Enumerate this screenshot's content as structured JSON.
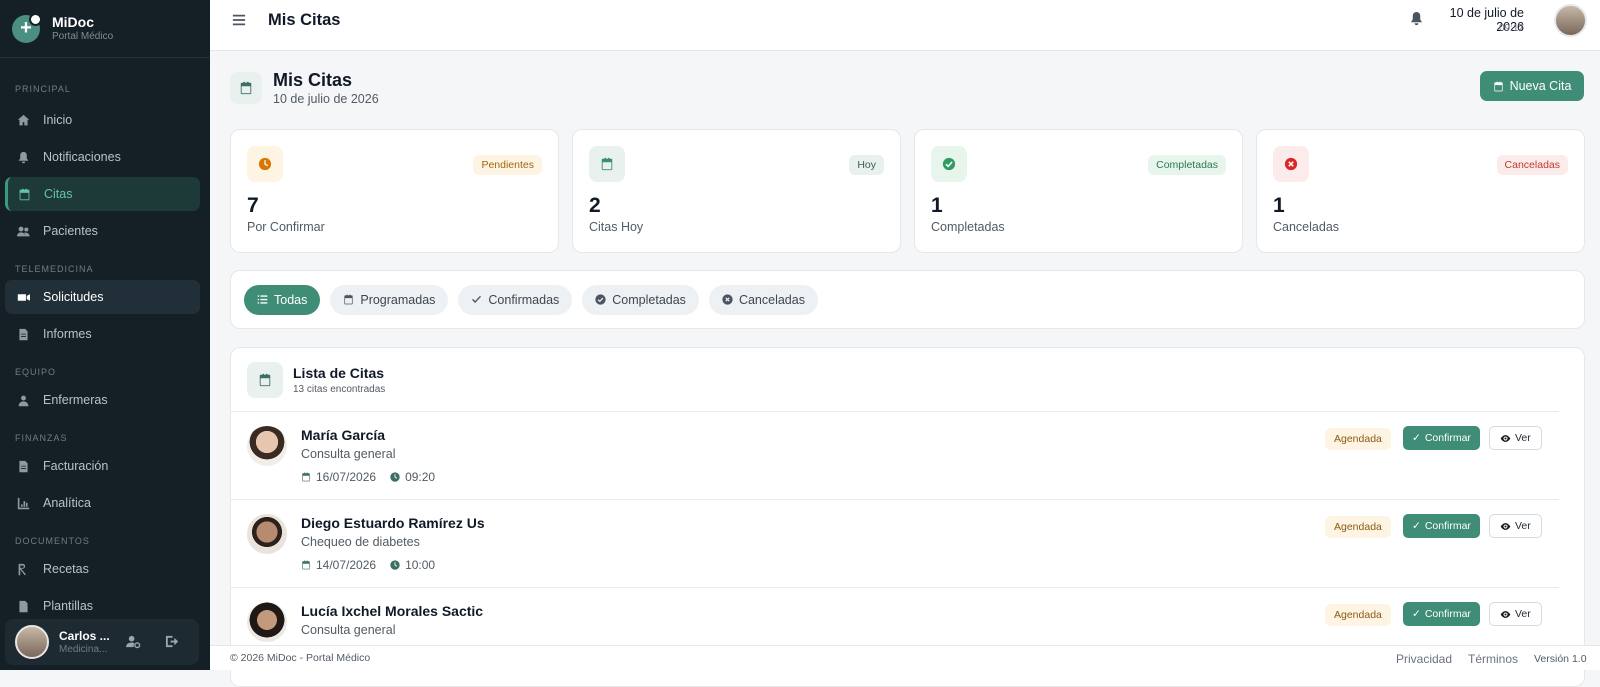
{
  "brand": {
    "name": "MiDoc",
    "subtitle": "Portal Médico"
  },
  "sidebar": {
    "sections": [
      "PRINCIPAL",
      "TELEMEDICINA",
      "EQUIPO",
      "FINANZAS",
      "DOCUMENTOS"
    ],
    "items": [
      {
        "label": "Inicio",
        "icon": "home-icon"
      },
      {
        "label": "Notificaciones",
        "icon": "bell-icon"
      },
      {
        "label": "Citas",
        "icon": "calendar-icon"
      },
      {
        "label": "Pacientes",
        "icon": "users-icon"
      },
      {
        "label": "Solicitudes",
        "icon": "video-icon"
      },
      {
        "label": "Informes",
        "icon": "document-icon"
      },
      {
        "label": "Enfermeras",
        "icon": "nurse-icon"
      },
      {
        "label": "Facturación",
        "icon": "invoice-icon"
      },
      {
        "label": "Analítica",
        "icon": "chart-icon"
      },
      {
        "label": "Recetas",
        "icon": "prescription-icon"
      },
      {
        "label": "Plantillas",
        "icon": "template-icon"
      }
    ],
    "user": {
      "name": "Carlos ...",
      "role": "Medicina..."
    }
  },
  "topbar": {
    "title": "Mis Citas",
    "date": "10 de julio de 2026",
    "time": "09:17"
  },
  "page": {
    "title": "Mis Citas",
    "subtitle": "10 de julio de 2026",
    "new_button": "Nueva Cita"
  },
  "stats": [
    {
      "badge": "Pendientes",
      "value": "7",
      "label": "Por Confirmar",
      "color": "#d97706",
      "bg": "#fdf4e3",
      "badge_color": "#a5650d"
    },
    {
      "badge": "Hoy",
      "value": "2",
      "label": "Citas Hoy",
      "color": "#3f8c77",
      "bg": "#e8f1ee",
      "badge_color": "#3a5f56"
    },
    {
      "badge": "Completadas",
      "value": "1",
      "label": "Completadas",
      "color": "#2f9d63",
      "bg": "#e7f5ec",
      "badge_color": "#2c7a4f"
    },
    {
      "badge": "Canceladas",
      "value": "1",
      "label": "Canceladas",
      "color": "#dc2626",
      "bg": "#fcebeb",
      "badge_color": "#c0392b"
    }
  ],
  "filters": [
    "Todas",
    "Programadas",
    "Confirmadas",
    "Completadas",
    "Canceladas"
  ],
  "list": {
    "title": "Lista de Citas",
    "count": "13 citas encontradas"
  },
  "appointments": [
    {
      "name": "María García",
      "desc": "Consulta general",
      "date": "16/07/2026",
      "time": "09:20",
      "status": "Agendada",
      "confirm": "Confirmar",
      "view": "Ver"
    },
    {
      "name": "Diego Estuardo Ramírez Us",
      "desc": "Chequeo de diabetes",
      "date": "14/07/2026",
      "time": "10:00",
      "status": "Agendada",
      "confirm": "Confirmar",
      "view": "Ver"
    },
    {
      "name": "Lucía Ixchel Morales Sactic",
      "desc": "Consulta general",
      "date": "",
      "time": "",
      "status": "Agendada",
      "confirm": "Confirmar",
      "view": "Ver"
    }
  ],
  "footer": {
    "copyright": "© 2026 MiDoc - Portal Médico",
    "privacy": "Privacidad",
    "terms": "Términos",
    "version": "Versión 1.0"
  }
}
